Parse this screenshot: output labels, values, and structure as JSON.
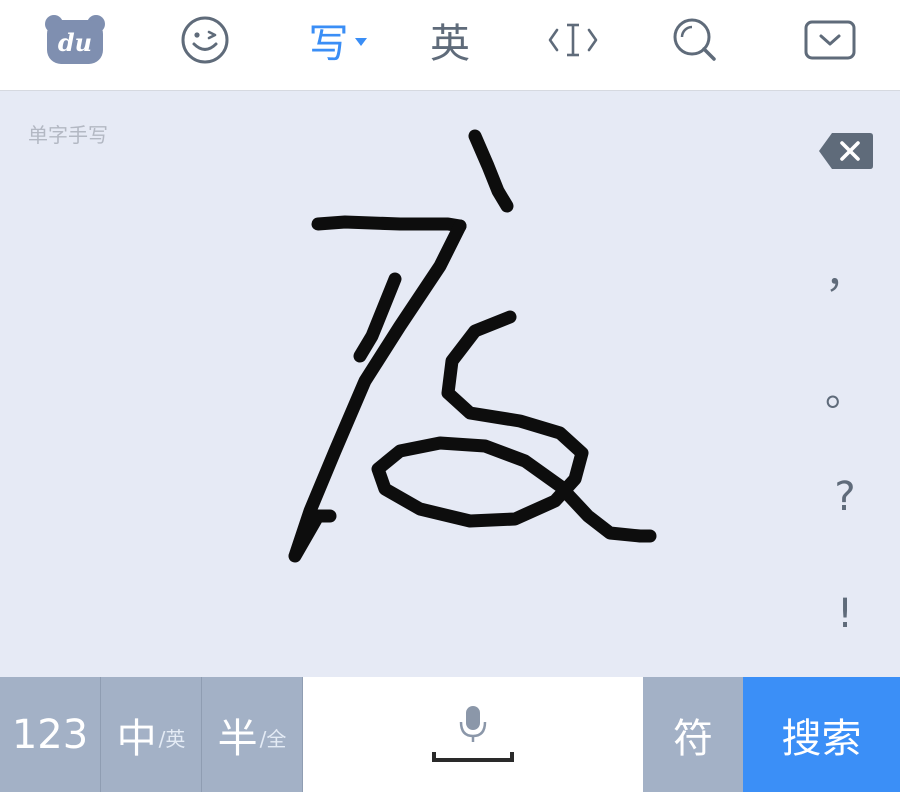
{
  "toolbar": {
    "logo_text": "du",
    "write_label": "写",
    "english_label": "英"
  },
  "handwriting": {
    "mode_label": "单字手写"
  },
  "side_keys": {
    "comma": "，",
    "period": "。",
    "question": "?",
    "exclaim": "!"
  },
  "bottom_row": {
    "numbers_label": "123",
    "zh_label": "中",
    "zh_sub": "/英",
    "half_label": "半",
    "half_sub": "/全",
    "symbols_label": "符",
    "search_label": "搜索"
  },
  "colors": {
    "accent": "#3b8ff7",
    "key_gray": "#a3b1c6",
    "canvas_bg": "#e6eaf5",
    "icon": "#5f6b7a"
  },
  "icons": {
    "logo": "baidu-bear-logo-icon",
    "emoji": "smiley-face-icon",
    "cursor": "text-cursor-icon",
    "search": "search-icon",
    "hide_keyboard": "hide-keyboard-icon",
    "backspace": "backspace-icon",
    "mic": "microphone-icon",
    "space": "space-bar-icon"
  }
}
